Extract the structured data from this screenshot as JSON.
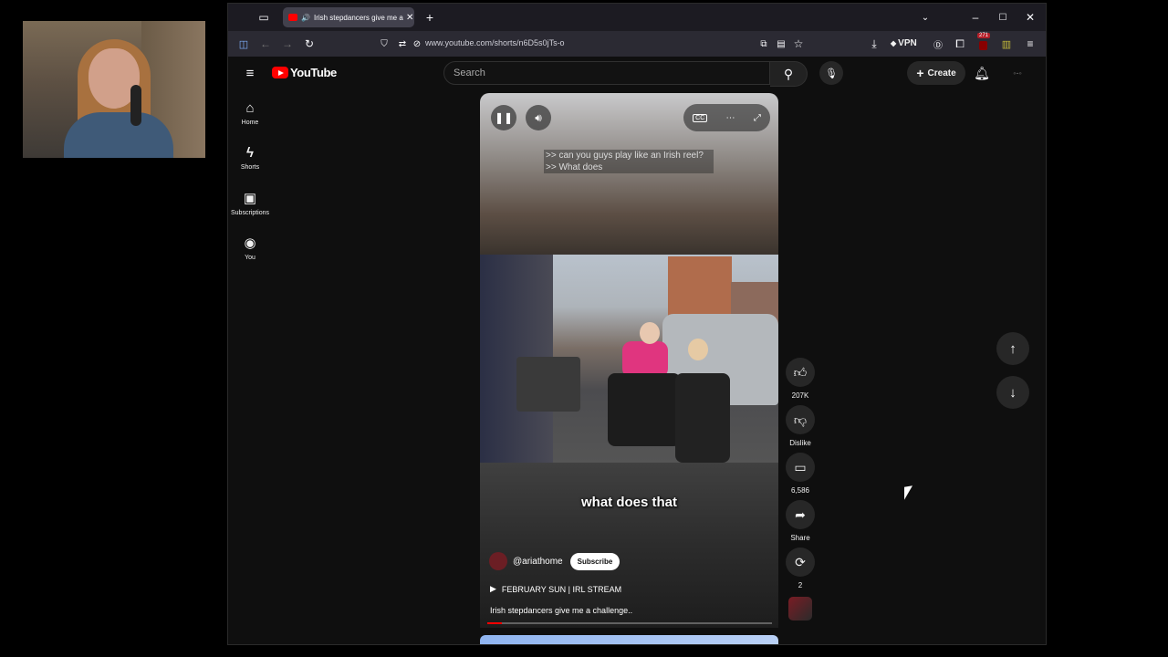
{
  "browser": {
    "tab_title": "Irish stepdancers give me a challenge",
    "url": "www.youtube.com/shorts/n6D5s0jTs-o",
    "vpn_label": "VPN",
    "extension_badge": "271"
  },
  "youtube": {
    "logo_text": "YouTube",
    "search_placeholder": "Search",
    "create_label": "Create",
    "sidebar": [
      {
        "label": "Home",
        "icon": "home-icon"
      },
      {
        "label": "Shorts",
        "icon": "shorts-icon"
      },
      {
        "label": "Subscriptions",
        "icon": "subscriptions-icon"
      },
      {
        "label": "You",
        "icon": "you-icon"
      }
    ]
  },
  "short": {
    "subtitle_lines": [
      ">> can you guys play like an Irish reel?",
      ">> What does"
    ],
    "caption": "what does that",
    "channel": "@ariathome",
    "subscribe_label": "Subscribe",
    "playlist": "FEBRUARY SUN | IRL STREAM",
    "description": "Irish stepdancers give me a challenge..",
    "progress": 0.05,
    "likes": "207K",
    "dislike_label": "Dislike",
    "comments": "6,586",
    "share_label": "Share",
    "remix_count": "2"
  },
  "colors": {
    "brand_red": "#ff0000",
    "background": "#0f0f0f",
    "button_bg": "#272727"
  }
}
